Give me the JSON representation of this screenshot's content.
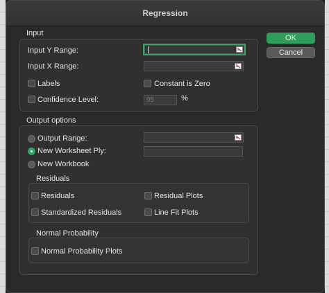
{
  "dialog": {
    "title": "Regression"
  },
  "buttons": {
    "ok": "OK",
    "cancel": "Cancel"
  },
  "input": {
    "section": "Input",
    "y_range_label": "Input Y Range:",
    "y_range_value": "",
    "x_range_label": "Input X Range:",
    "x_range_value": "",
    "labels_label": "Labels",
    "labels_checked": false,
    "constant_zero_label": "Constant is Zero",
    "constant_zero_checked": false,
    "confidence_label": "Confidence Level:",
    "confidence_checked": false,
    "confidence_value": "95",
    "percent": "%"
  },
  "output": {
    "section": "Output options",
    "output_range_label": "Output Range:",
    "new_ply_label": "New Worksheet Ply:",
    "new_workbook_label": "New Workbook",
    "selected": "new_worksheet_ply"
  },
  "residuals": {
    "section": "Residuals",
    "residuals_label": "Residuals",
    "residual_plots_label": "Residual Plots",
    "standardized_label": "Standardized Residuals",
    "line_fit_label": "Line Fit Plots"
  },
  "normal": {
    "section": "Normal Probability",
    "plots_label": "Normal Probability Plots"
  },
  "colors": {
    "accent": "#2f9e5c",
    "focus": "#3f9e6a",
    "background": "#2a2a2a"
  }
}
